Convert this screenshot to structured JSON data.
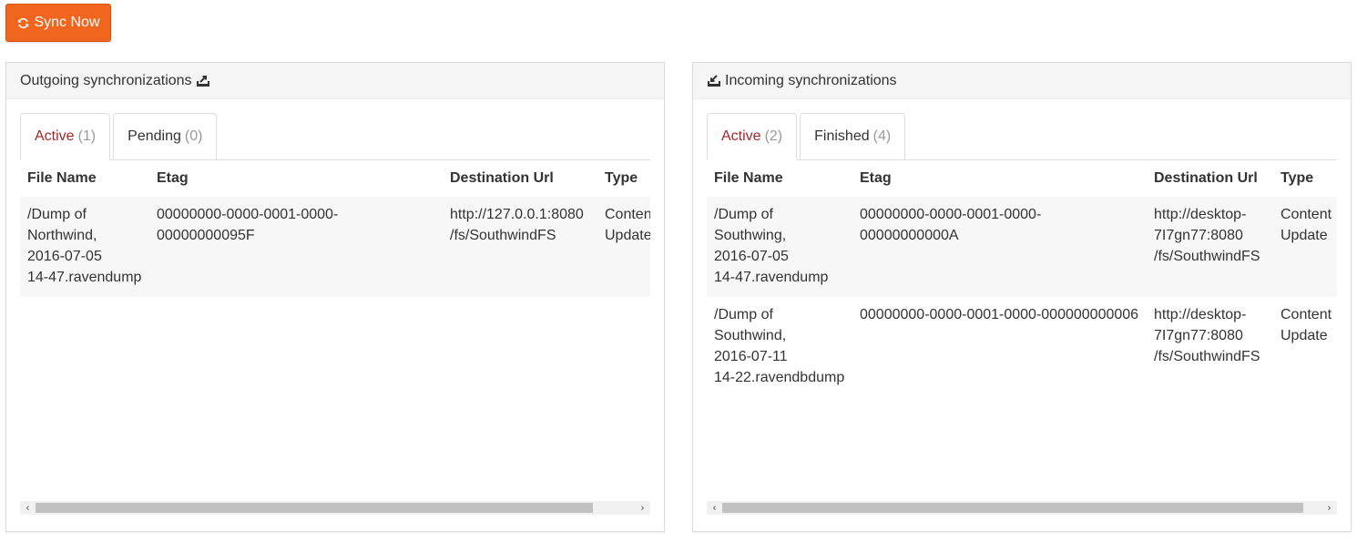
{
  "toolbar": {
    "sync_button_label": "Sync Now",
    "sync_icon": "refresh-icon",
    "accent_color": "#f0661e"
  },
  "outgoing": {
    "title": "Outgoing synchronizations",
    "icon": "upload-tray-icon",
    "tabs": [
      {
        "label": "Active",
        "count": "(1)"
      },
      {
        "label": "Pending",
        "count": "(0)"
      }
    ],
    "columns": [
      "File Name",
      "Etag",
      "Destination Url",
      "Type"
    ],
    "rows": [
      {
        "file_name": [
          "/Dump of",
          "Northwind,",
          "2016-07-05",
          "14-47.ravendump"
        ],
        "etag": "00000000-0000-0001-0000-00000000095F",
        "destination_url": [
          "http://127.0.0.1:8080",
          "/fs/SouthwindFS"
        ],
        "type": [
          "Content",
          "Update"
        ]
      }
    ],
    "scroll_fraction": 0.93
  },
  "incoming": {
    "title": "Incoming synchronizations",
    "icon": "download-tray-icon",
    "tabs": [
      {
        "label": "Active",
        "count": "(2)"
      },
      {
        "label": "Finished",
        "count": "(4)"
      }
    ],
    "columns": [
      "File Name",
      "Etag",
      "Destination Url",
      "Type"
    ],
    "rows": [
      {
        "file_name": [
          "/Dump of",
          "Southwing,",
          "2016-07-05",
          "14-47.ravendump"
        ],
        "etag": "00000000-0000-0001-0000-00000000000A",
        "destination_url": [
          "http://desktop-",
          "7I7gn77:8080",
          "/fs/SouthwindFS"
        ],
        "type": [
          "Content",
          "Update"
        ]
      },
      {
        "file_name": [
          "/Dump of",
          "Southwind,",
          "2016-07-11",
          "14-22.ravendbdump"
        ],
        "etag": "00000000-0000-0001-0000-000000000006",
        "destination_url": [
          "http://desktop-",
          "7I7gn77:8080",
          "/fs/SouthwindFS"
        ],
        "type": [
          "Content",
          "Update"
        ]
      }
    ],
    "scroll_fraction": 0.97
  }
}
